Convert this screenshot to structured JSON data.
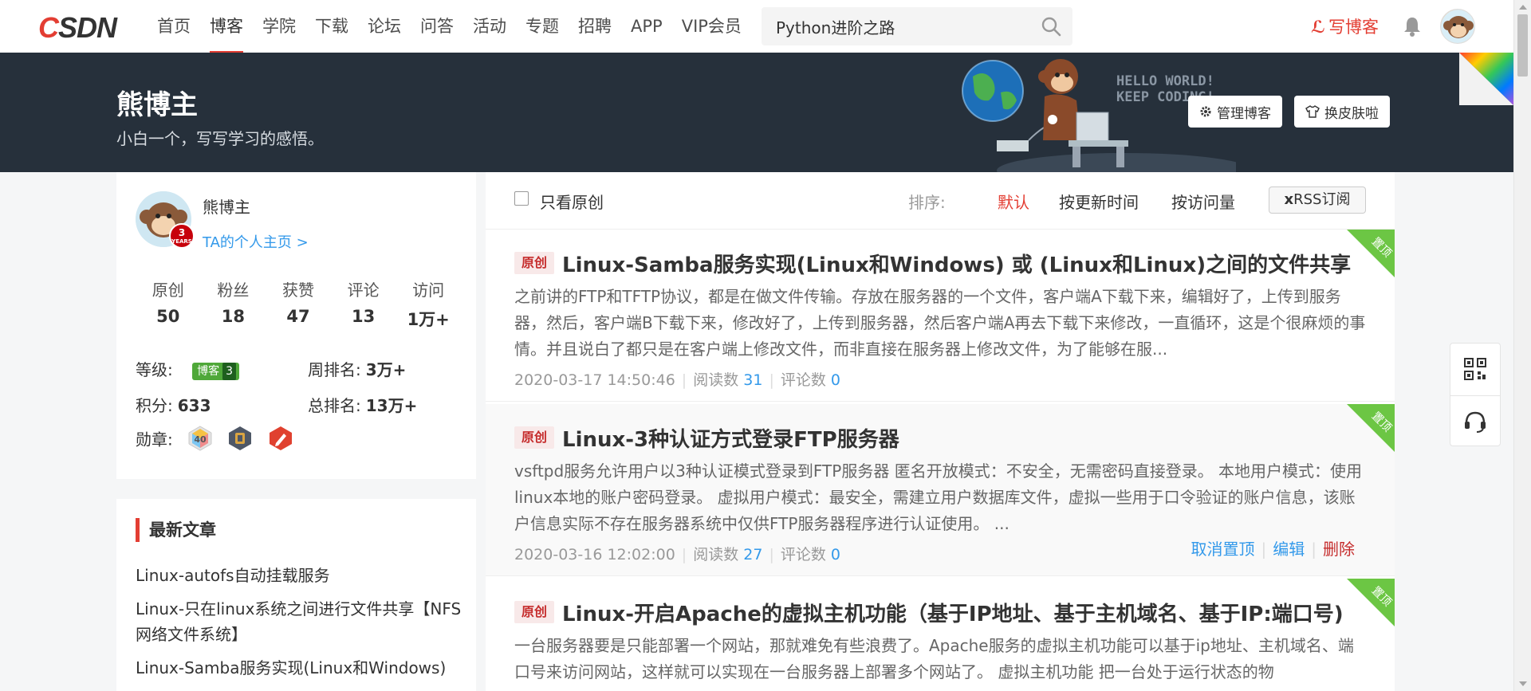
{
  "nav": {
    "logo": "CSDN",
    "items": [
      "首页",
      "博客",
      "学院",
      "下载",
      "论坛",
      "问答",
      "活动",
      "专题",
      "招聘",
      "APP",
      "VIP会员"
    ],
    "active": "博客",
    "search_value": "Python进阶之路",
    "write_label": "写博客"
  },
  "banner": {
    "title": "熊博主",
    "desc": "小白一个，写写学习的感悟。",
    "hello_line1": "HELLO WORLD!",
    "hello_line2": "KEEP CODING!",
    "manage_label": "管理博客",
    "skin_label": "换皮肤啦"
  },
  "profile": {
    "name": "熊博主",
    "home_link": "TA的个人主页 >",
    "years_num": "3",
    "years_text": "YEARS",
    "stats": [
      {
        "label": "原创",
        "value": "50"
      },
      {
        "label": "粉丝",
        "value": "18"
      },
      {
        "label": "获赞",
        "value": "47"
      },
      {
        "label": "评论",
        "value": "13"
      },
      {
        "label": "访问",
        "value": "1万+"
      }
    ],
    "level_label": "等级:",
    "level_badge_text": "博客",
    "level_badge_num": "3",
    "week_rank_label": "周排名:",
    "week_rank": "3万+",
    "points_label": "积分:",
    "points": "633",
    "total_rank_label": "总排名:",
    "total_rank": "13万+",
    "medal_label": "勋章:",
    "medal_text": "40"
  },
  "latest": {
    "heading": "最新文章",
    "items": [
      "Linux-autofs自动挂载服务",
      "Linux-只在linux系统之间进行文件共享【NFS网络文件系统】",
      "Linux-Samba服务实现(Linux和Windows)"
    ]
  },
  "filter": {
    "only_original": "只看原创",
    "sort_label": "排序:",
    "sort_options": [
      "默认",
      "按更新时间",
      "按访问量"
    ],
    "rss_label": "RSS订阅"
  },
  "articles": [
    {
      "tag": "原创",
      "title": "Linux-Samba服务实现(Linux和Windows) 或 (Linux和Linux)之间的文件共享",
      "summary": "之前讲的FTP和TFTP协议，都是在做文件传输。存放在服务器的一个文件，客户端A下载下来，编辑好了，上传到服务器，然后，客户端B下载下来，修改好了，上传到服务器，然后客户端A再去下载下来修改，一直循环，这是个很麻烦的事情。并且说白了都只是在客户端上修改文件，而非直接在服务器上修改文件，为了能够在服...",
      "date": "2020-03-17 14:50:46",
      "reads_label": "阅读数",
      "reads": "31",
      "comments_label": "评论数",
      "comments": "0",
      "pin": "置顶"
    },
    {
      "tag": "原创",
      "title": "Linux-3种认证方式登录FTP服务器",
      "summary": "vsftpd服务允许用户以3种认证模式登录到FTP服务器 匿名开放模式：不安全，无需密码直接登录。 本地用户模式：使用linux本地的账户密码登录。 虚拟用户模式：最安全，需建立用户数据库文件，虚拟一些用于口令验证的账户信息，该账户信息实际不存在服务器系统中仅供FTP服务器程序进行认证使用。 ...",
      "date": "2020-03-16 12:02:00",
      "reads_label": "阅读数",
      "reads": "27",
      "comments_label": "评论数",
      "comments": "0",
      "pin": "置顶",
      "actions": [
        "取消置顶",
        "编辑",
        "删除"
      ]
    },
    {
      "tag": "原创",
      "title": "Linux-开启Apache的虚拟主机功能（基于IP地址、基于主机域名、基于IP:端口号)",
      "summary": "一台服务器要是只能部署一个网站，那就难免有些浪费了。Apache服务的虚拟主机功能可以基于ip地址、主机域名、端口号来访问网站，这样就可以实现在一台服务器上部署多个网站了。 虚拟主机功能 把一台处于运行状态的物",
      "pin": "置顶"
    }
  ],
  "colors": {
    "brand_red": "#e33e33",
    "banner_bg": "#26303b",
    "link_blue": "#3399ea",
    "pin_green": "#6cc644"
  }
}
